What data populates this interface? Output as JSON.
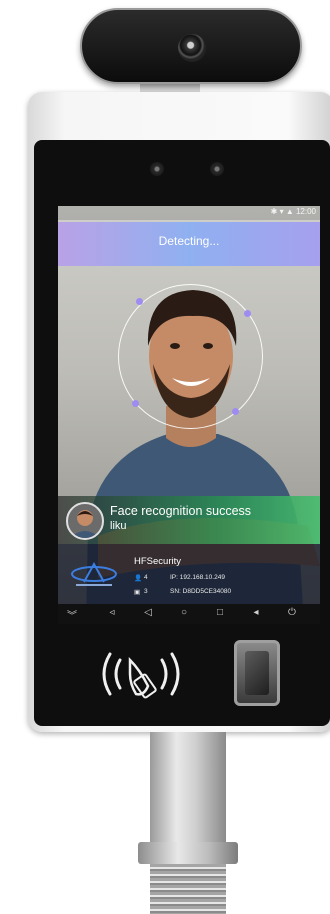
{
  "status_bar": {
    "text": "✱ ▾ ▲ 12:00"
  },
  "detect_banner": {
    "text": "Detecting..."
  },
  "recognition": {
    "title": "Face recognition success",
    "name": "liku"
  },
  "info_panel": {
    "company": "HFSecurity",
    "person_count": "4",
    "ip_label": "IP: 192.168.10.249",
    "face_count": "3",
    "sn_label": "SN: D8DD5CE34080"
  },
  "colors": {
    "detect_banner_start": "#b9a2e6",
    "success_green": "#46be6e",
    "device_body": "#f6f6f6",
    "bezel": "#0e0e0e"
  },
  "nav_icons": [
    "chevron-down-icon",
    "volume-icon",
    "back-icon",
    "home-icon",
    "recent-icon",
    "volume-up-icon",
    "power-icon"
  ]
}
